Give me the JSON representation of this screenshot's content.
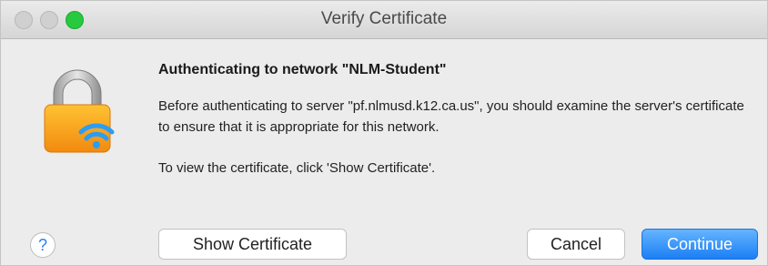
{
  "window": {
    "title": "Verify Certificate"
  },
  "dialog": {
    "heading": "Authenticating to network \"NLM-Student\"",
    "message": "Before authenticating to server \"pf.nlmusd.k12.ca.us\", you should examine the server's certificate to ensure that it is appropriate for this network.",
    "hint": "To view the certificate, click 'Show Certificate'."
  },
  "buttons": {
    "help": "?",
    "show_certificate": "Show Certificate",
    "cancel": "Cancel",
    "continue": "Continue"
  },
  "icons": {
    "lock": "wifi-lock-icon",
    "help": "help-icon"
  },
  "colors": {
    "accent": "#1b7ff4",
    "lock_body": "#f7a21b",
    "zoom_button": "#27c93f"
  }
}
